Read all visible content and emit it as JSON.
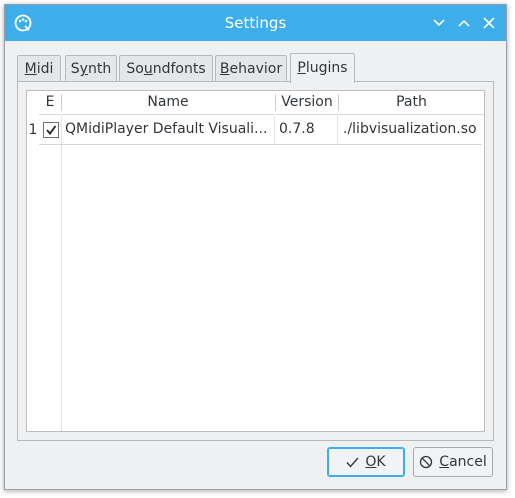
{
  "window": {
    "title": "Settings",
    "controls": [
      "minimize-icon",
      "maximize-icon",
      "close-icon"
    ]
  },
  "tabs": [
    {
      "pre": "",
      "mn": "M",
      "post": "idi"
    },
    {
      "pre": "S",
      "mn": "y",
      "post": "nth"
    },
    {
      "pre": "So",
      "mn": "u",
      "post": "ndfonts"
    },
    {
      "pre": "",
      "mn": "B",
      "post": "ehavior"
    },
    {
      "pre": "",
      "mn": "P",
      "post": "lugins"
    }
  ],
  "active_tab": "Plugins",
  "table": {
    "headers": [
      "E",
      "Name",
      "Version",
      "Path"
    ],
    "rows": [
      {
        "index": "1",
        "enabled": true,
        "name": "QMidiPlayer Default Visuali...",
        "version": "0.7.8",
        "path": "./libvisualization.so"
      }
    ]
  },
  "buttons": {
    "ok": {
      "mn": "O",
      "post": "K"
    },
    "cancel": {
      "mn": "C",
      "post": "ancel"
    }
  },
  "colors": {
    "titlebar": "#3daee9",
    "window_bg": "#eff0f1",
    "text": "#31363b",
    "focus": "#3daee9"
  }
}
